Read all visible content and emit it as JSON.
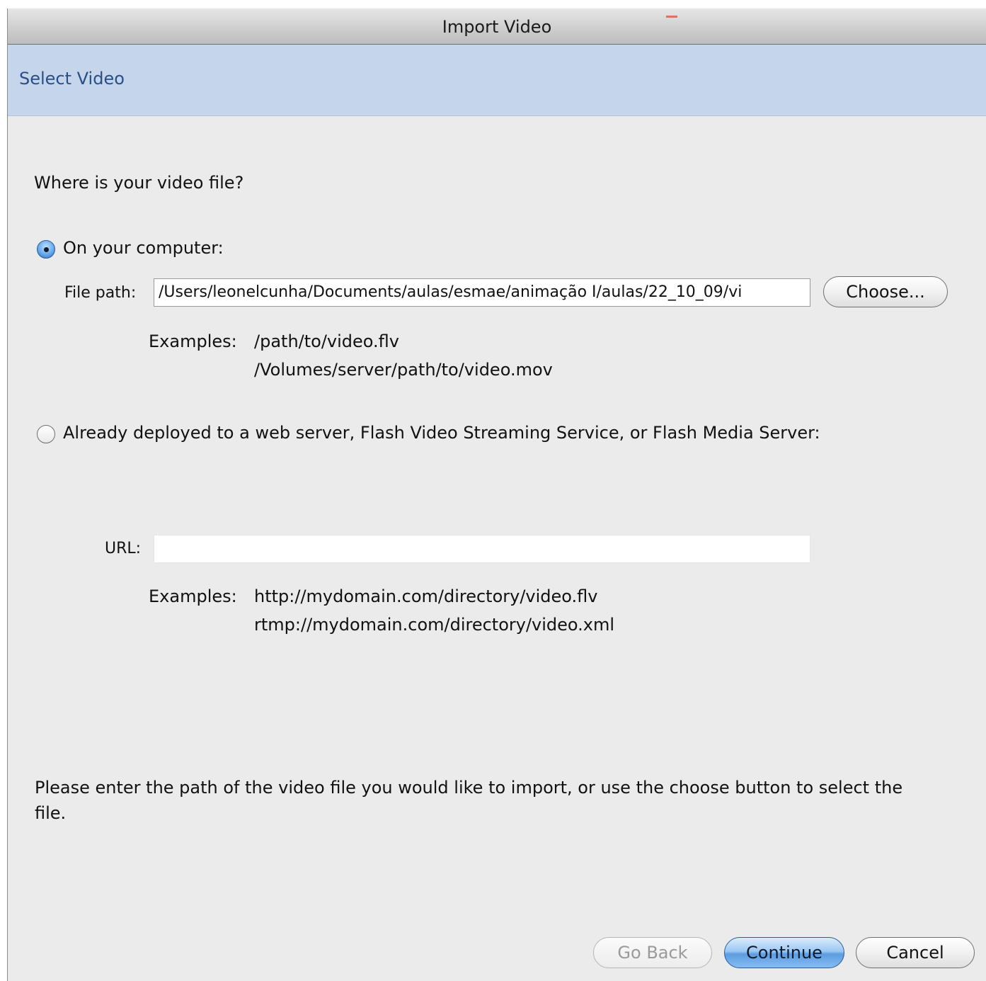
{
  "window": {
    "title": "Import Video"
  },
  "header": {
    "title": "Select Video"
  },
  "question": "Where is your video file?",
  "option_computer": {
    "label": "On your computer:",
    "selected": true,
    "file_path_label": "File path:",
    "file_path_value": "/Users/leonelcunha/Documents/aulas/esmae/animação I/aulas/22_10_09/vi",
    "choose_label": "Choose...",
    "examples_label": "Examples:",
    "examples": [
      "/path/to/video.flv",
      "/Volumes/server/path/to/video.mov"
    ]
  },
  "option_server": {
    "label": "Already deployed to a web server, Flash Video Streaming Service, or Flash Media Server:",
    "selected": false,
    "url_label": "URL:",
    "url_value": "",
    "examples_label": "Examples:",
    "examples": [
      "http://mydomain.com/directory/video.flv",
      "rtmp://mydomain.com/directory/video.xml"
    ]
  },
  "hint": {
    "line1": "Please enter the path of the video file you would like to import, or use the choose button to select the",
    "line2": "file."
  },
  "footer": {
    "go_back_label": "Go Back",
    "go_back_enabled": false,
    "continue_label": "Continue",
    "cancel_label": "Cancel"
  }
}
